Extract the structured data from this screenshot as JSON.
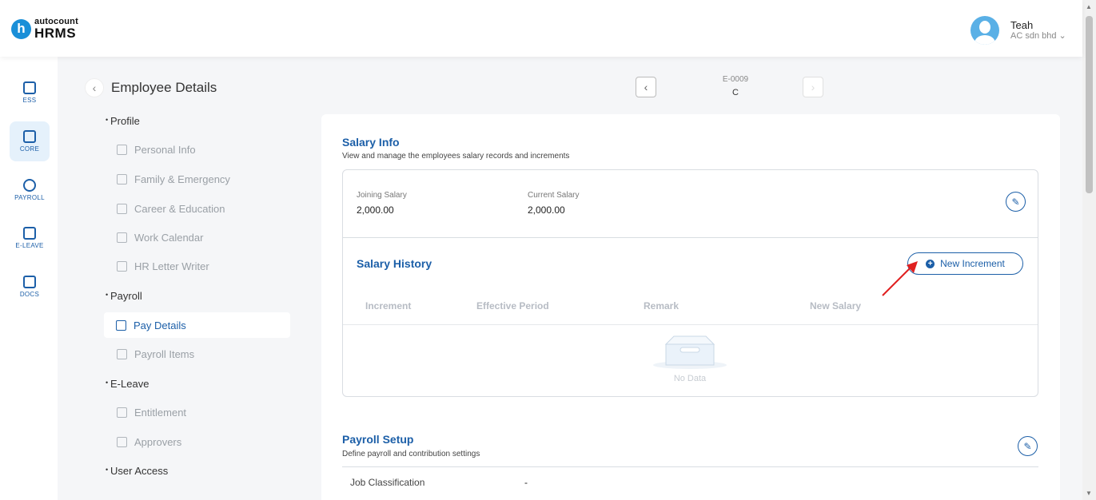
{
  "header": {
    "logo_top": "autocount",
    "logo_bottom": "HRMS",
    "logo_letter": "h",
    "user_name": "Teah",
    "user_company": "AC sdn bhd"
  },
  "rail": [
    {
      "label": "ESS",
      "icon": "ess-icon"
    },
    {
      "label": "CORE",
      "icon": "core-icon"
    },
    {
      "label": "PAYROLL",
      "icon": "payroll-icon"
    },
    {
      "label": "E-LEAVE",
      "icon": "calendar-icon"
    },
    {
      "label": "DOCS",
      "icon": "docs-icon"
    }
  ],
  "subnav": {
    "title": "Employee Details",
    "sections": [
      "Profile",
      "Payroll",
      "E-Leave",
      "User Access"
    ],
    "items": [
      "Personal Info",
      "Family & Emergency",
      "Career & Education",
      "Work Calendar",
      "HR Letter Writer",
      "Pay Details",
      "Payroll Items",
      "Entitlement",
      "Approvers"
    ]
  },
  "employee": {
    "code": "E-0009",
    "name": "C"
  },
  "salary_info": {
    "title": "Salary Info",
    "subtitle": "View and manage the employees salary records and increments",
    "joining_label": "Joining Salary",
    "joining_value": "2,000.00",
    "current_label": "Current Salary",
    "current_value": "2,000.00"
  },
  "salary_history": {
    "title": "Salary History",
    "new_button": "New Increment",
    "columns": [
      "Increment",
      "Effective Period",
      "Remark",
      "New Salary"
    ],
    "empty_text": "No Data"
  },
  "payroll_setup": {
    "title": "Payroll Setup",
    "subtitle": "Define payroll and contribution settings",
    "job_label": "Job Classification",
    "job_value": "-"
  },
  "colors": {
    "accent": "#1c5fa8",
    "logo": "#1a8fd8",
    "annotation_arrow": "#e02020"
  }
}
